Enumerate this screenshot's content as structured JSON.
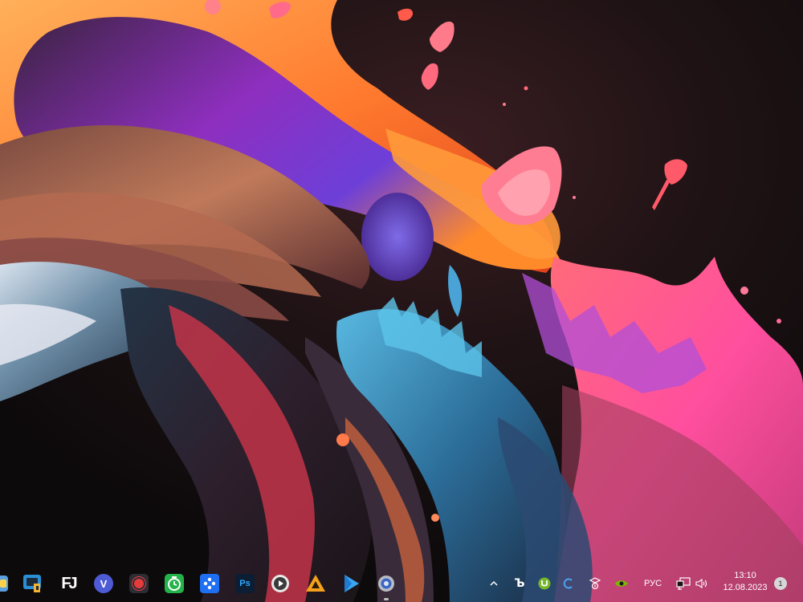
{
  "taskbar": {
    "apps": [
      {
        "name": "partial-app-icon"
      },
      {
        "name": "screen-capture-app-icon"
      },
      {
        "name": "fl-studio-icon",
        "glyph": "FJ"
      },
      {
        "name": "viber-icon",
        "glyph": "V"
      },
      {
        "name": "screen-recorder-icon"
      },
      {
        "name": "clock-app-icon"
      },
      {
        "name": "gamepad-app-icon"
      },
      {
        "name": "photoshop-icon",
        "glyph": "Ps"
      },
      {
        "name": "media-player-icon"
      },
      {
        "name": "aimp-icon"
      },
      {
        "name": "play-store-icon"
      },
      {
        "name": "settings-gear-icon"
      }
    ],
    "tray": {
      "chevron": "^",
      "browser_glyph": "Ъ",
      "language": "РУС",
      "time": "13:10",
      "date": "12.08.2023",
      "notifications_count": "1"
    }
  },
  "colors": {
    "accent_orange": "#ff8a3a",
    "accent_pink": "#ff5f9a",
    "accent_purple": "#9b3fd6",
    "accent_blue": "#3a8fd8"
  }
}
